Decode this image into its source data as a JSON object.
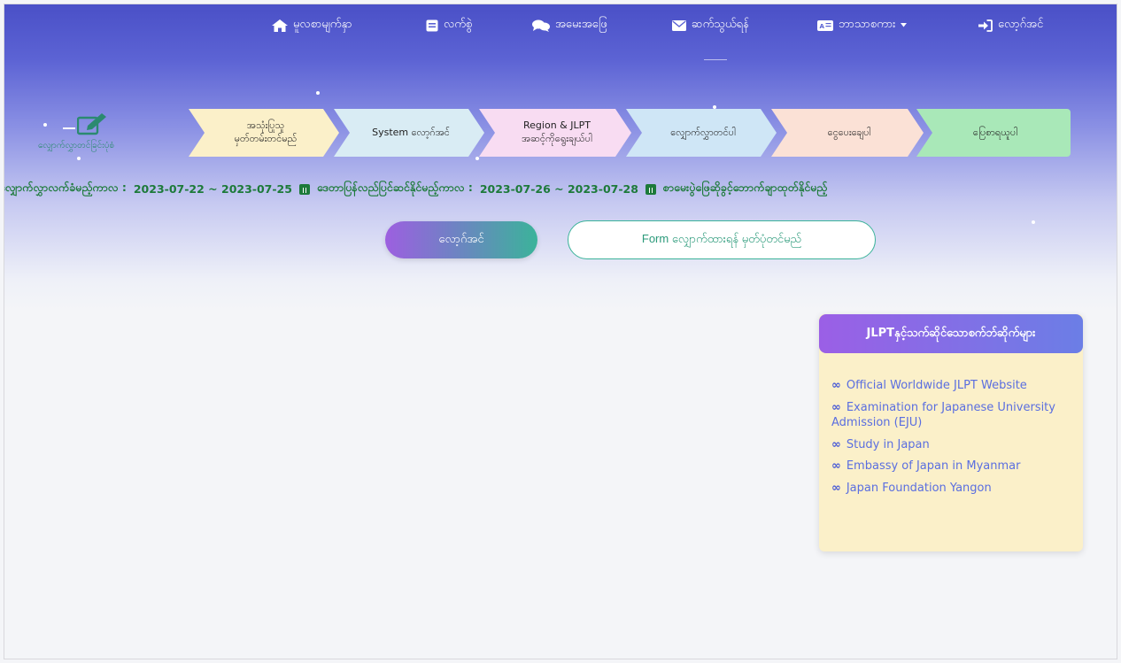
{
  "nav": {
    "home": "မူလစာမျက်နှာ",
    "manual": "လက်စွဲ",
    "faq": "အမေးအဖြေ",
    "contact": "ဆက်သွယ်ရန်",
    "language": "ဘာသာစကား",
    "login": "လော့ဂ်အင်"
  },
  "steps": {
    "label": "လျှောက်လွှာတင်ခြင်းပုံစံ",
    "items": [
      {
        "line1": "အသုံးပြုသူ",
        "line2": "မှတ်တမ်းတင်မည်",
        "color": "#fbf0c9"
      },
      {
        "line1": "System လော့ဂ်အင်",
        "line2": "",
        "color": "#d9ecf4"
      },
      {
        "line1": "Region & JLPT",
        "line2": "အဆင့်ကိုရွေးချယ်ပါ",
        "color": "#f8dcf2"
      },
      {
        "line1": "လျှောက်လွှာတင်ပါ",
        "line2": "",
        "color": "#cfe6f6"
      },
      {
        "line1": "ငွေပေးချေပါ",
        "line2": "",
        "color": "#fbe1d6"
      },
      {
        "line1": "ပြေစာရယူပါ",
        "line2": "",
        "color": "#a9e8b8"
      }
    ]
  },
  "period": {
    "apply_label": "လျှောက်လွှာလက်ခံမည့်ကာလ :",
    "apply_range": "2023-07-22 ~ 2023-07-25",
    "edit_label": "ဒေတာပြန်လည်ပြင်ဆင်နိုင်မည့်ကာလ :",
    "edit_range": "2023-07-26 ~ 2023-07-28",
    "ticket_label": "စာမေးပွဲဖြေဆိုခွင့်ဘောက်ချာထုတ်နိုင်မည့်"
  },
  "actions": {
    "login_button": "လော့ဂ်အင်",
    "form_button": "Form လျှောက်ထားရန် မှတ်ပုံတင်မည်"
  },
  "links_card": {
    "title": "JLPTနှင့်သက်ဆိုင်သောစက်ဘ်ဆိုက်များ",
    "links": [
      "Official Worldwide JLPT Website",
      "Examination for Japanese University Admission (EJU)",
      "Study in Japan",
      "Embassy of Japan in Myanmar",
      "Japan Foundation Yangon"
    ]
  },
  "colors": {
    "brand_top": "#4a50c7",
    "accent_green": "#3bb39a",
    "link_blue": "#5a6ee0",
    "period_green": "#1d7a3a"
  }
}
